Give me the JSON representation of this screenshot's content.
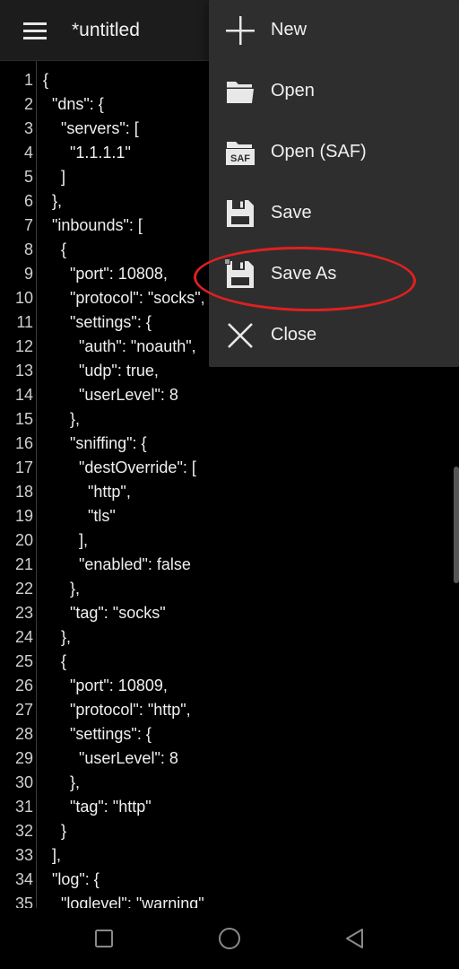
{
  "appbar": {
    "title": "*untitled",
    "menu_icon": "hamburger-menu-icon"
  },
  "editor": {
    "lines": [
      {
        "n": "1",
        "text": "{"
      },
      {
        "n": "2",
        "text": "  \"dns\": {"
      },
      {
        "n": "3",
        "text": "    \"servers\": ["
      },
      {
        "n": "4",
        "text": "      \"1.1.1.1\""
      },
      {
        "n": "5",
        "text": "    ]"
      },
      {
        "n": "6",
        "text": "  },"
      },
      {
        "n": "7",
        "text": "  \"inbounds\": ["
      },
      {
        "n": "8",
        "text": "    {"
      },
      {
        "n": "9",
        "text": "      \"port\": 10808,"
      },
      {
        "n": "10",
        "text": "      \"protocol\": \"socks\","
      },
      {
        "n": "11",
        "text": "      \"settings\": {"
      },
      {
        "n": "12",
        "text": "        \"auth\": \"noauth\","
      },
      {
        "n": "13",
        "text": "        \"udp\": true,"
      },
      {
        "n": "14",
        "text": "        \"userLevel\": 8"
      },
      {
        "n": "15",
        "text": "      },"
      },
      {
        "n": "16",
        "text": "      \"sniffing\": {"
      },
      {
        "n": "17",
        "text": "        \"destOverride\": ["
      },
      {
        "n": "18",
        "text": "          \"http\","
      },
      {
        "n": "19",
        "text": "          \"tls\""
      },
      {
        "n": "20",
        "text": "        ],"
      },
      {
        "n": "21",
        "text": "        \"enabled\": false"
      },
      {
        "n": "22",
        "text": "      },"
      },
      {
        "n": "23",
        "text": "      \"tag\": \"socks\""
      },
      {
        "n": "24",
        "text": "    },"
      },
      {
        "n": "25",
        "text": "    {"
      },
      {
        "n": "26",
        "text": "      \"port\": 10809,"
      },
      {
        "n": "27",
        "text": "      \"protocol\": \"http\","
      },
      {
        "n": "28",
        "text": "      \"settings\": {"
      },
      {
        "n": "29",
        "text": "        \"userLevel\": 8"
      },
      {
        "n": "30",
        "text": "      },"
      },
      {
        "n": "31",
        "text": "      \"tag\": \"http\""
      },
      {
        "n": "32",
        "text": "    }"
      },
      {
        "n": "33",
        "text": "  ],"
      },
      {
        "n": "34",
        "text": "  \"log\": {"
      },
      {
        "n": "35",
        "text": "    \"loglevel\": \"warning\""
      }
    ]
  },
  "menu": {
    "items": [
      {
        "id": "new",
        "label": "New",
        "icon": "plus-icon"
      },
      {
        "id": "open",
        "label": "Open",
        "icon": "folder-open-icon"
      },
      {
        "id": "open-saf",
        "label": "Open (SAF)",
        "icon": "folder-saf-icon",
        "badge": "SAF"
      },
      {
        "id": "save",
        "label": "Save",
        "icon": "floppy-disk-icon"
      },
      {
        "id": "save-as",
        "label": "Save As",
        "icon": "floppy-disk-save-as-icon"
      },
      {
        "id": "close",
        "label": "Close",
        "icon": "close-icon"
      }
    ],
    "highlighted": "save-as",
    "highlight_color": "#e02020"
  },
  "navbar": {
    "buttons": [
      {
        "id": "recents",
        "icon": "square-recents-icon"
      },
      {
        "id": "home",
        "icon": "circle-home-icon"
      },
      {
        "id": "back",
        "icon": "triangle-back-icon"
      }
    ]
  }
}
